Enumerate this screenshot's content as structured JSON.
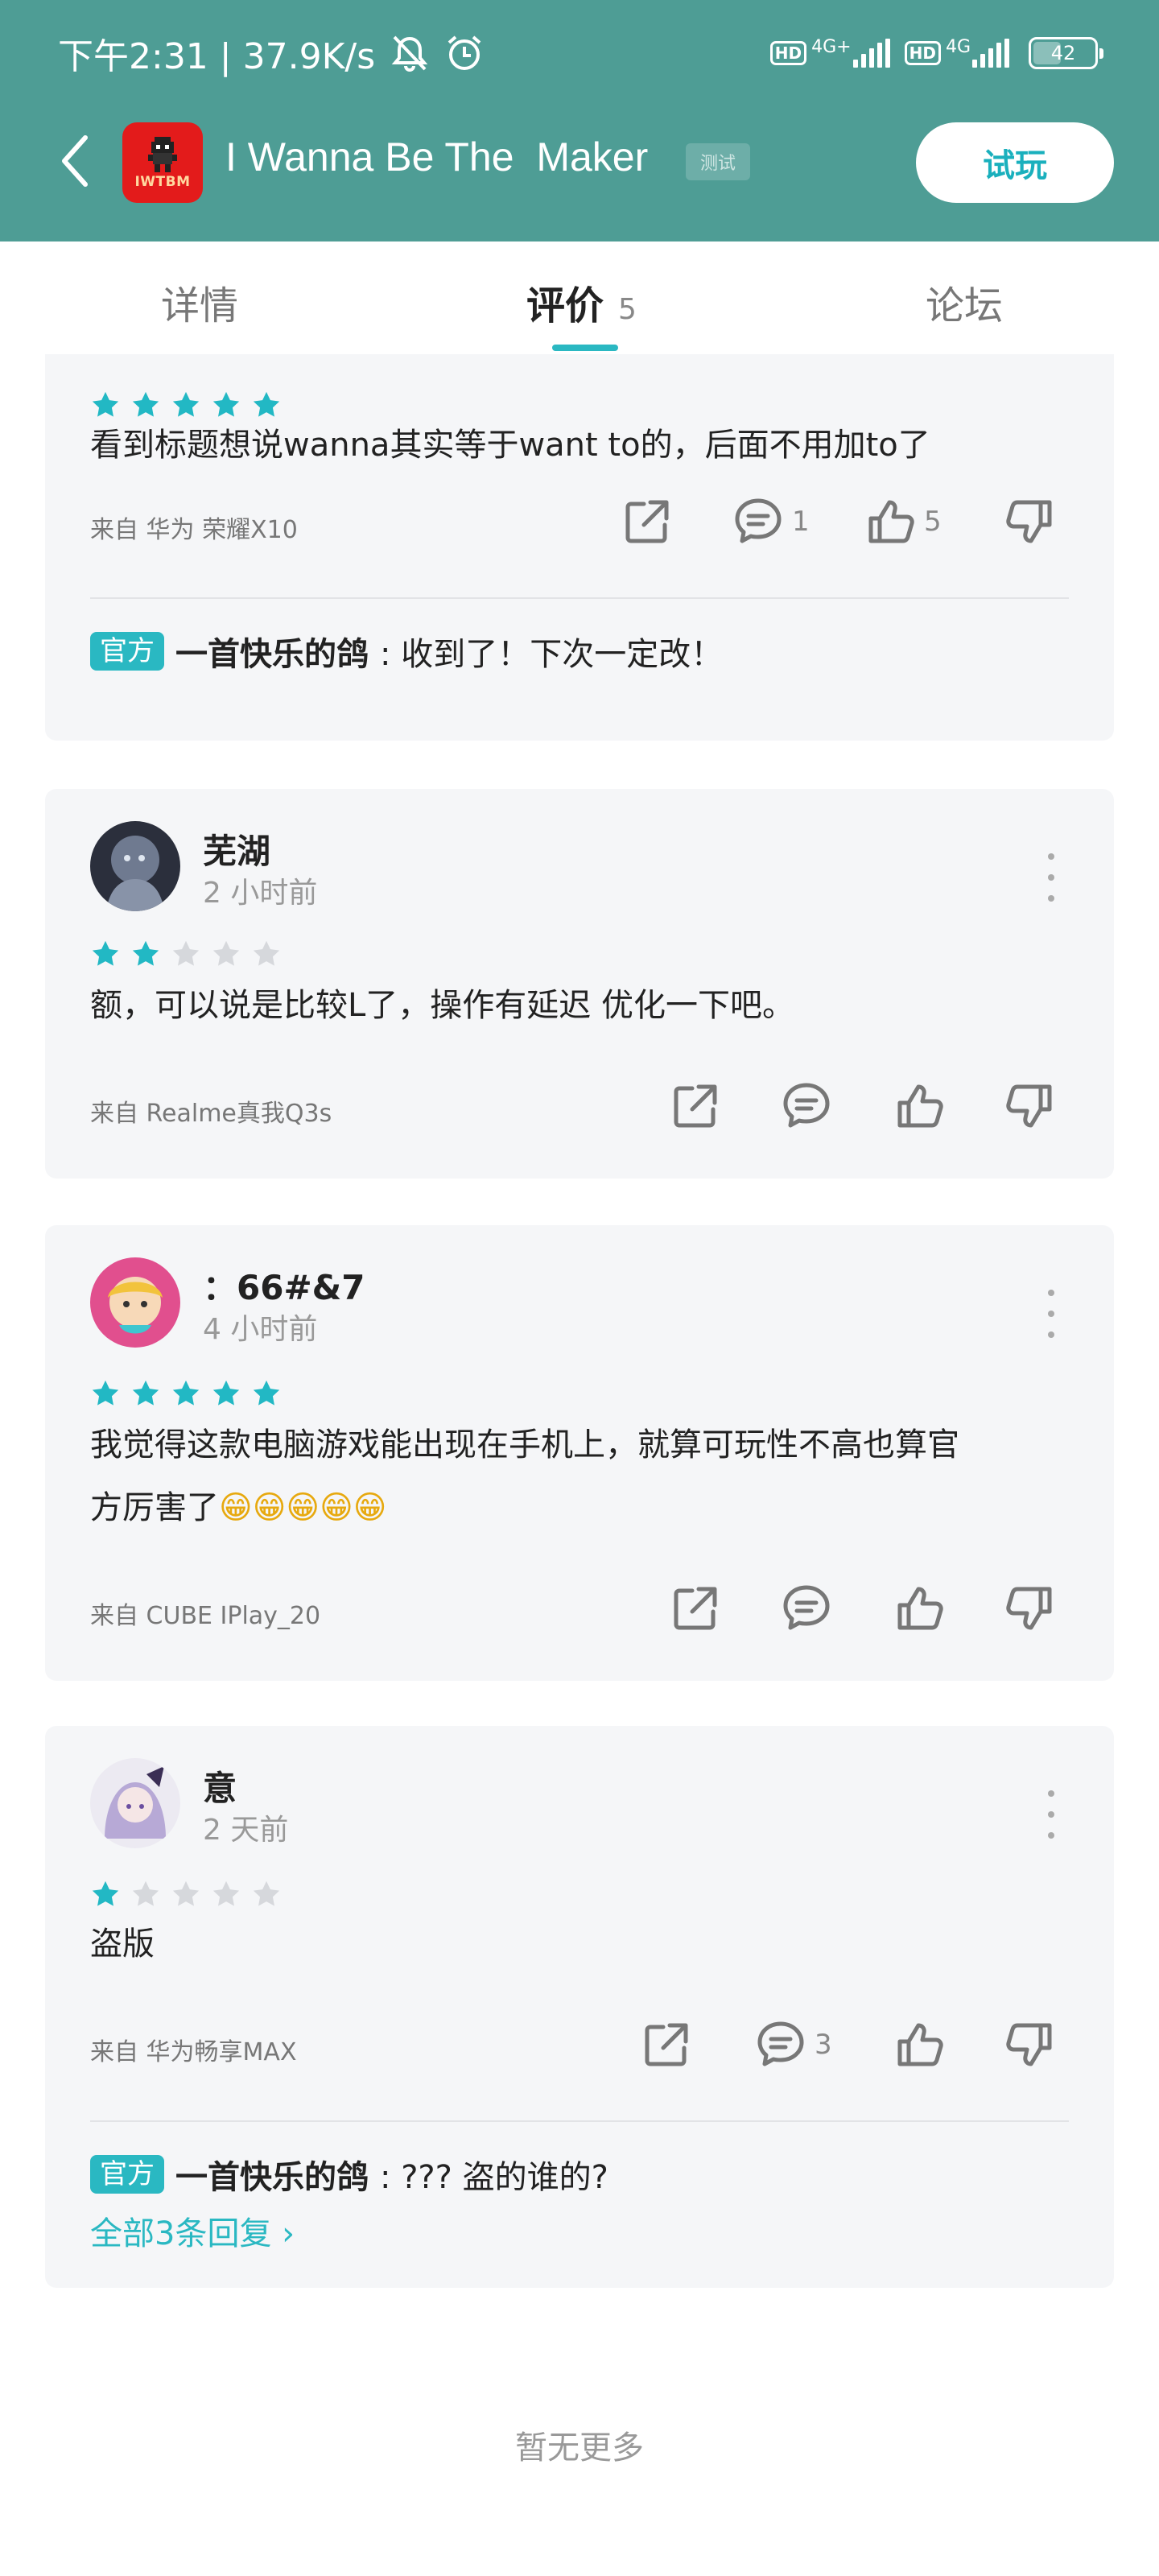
{
  "status_bar": {
    "time_speed": "下午2:31 | 37.9K/s",
    "icons": [
      "mute-icon",
      "alarm-icon"
    ],
    "hd1": "HD",
    "net1": "4G+",
    "hd2": "HD",
    "net2": "4G",
    "battery": "42"
  },
  "header": {
    "app_icon_text": "IWTBM",
    "title": "I Wanna Be The  Maker",
    "tag": "测试",
    "try_button": "试玩",
    "accent_color": "#4e9d95"
  },
  "tabs": [
    {
      "label": "详情"
    },
    {
      "label": "评价",
      "count": "5"
    },
    {
      "label": "论坛"
    }
  ],
  "reviews": [
    {
      "stars": 5,
      "text": "看到标题想说wanna其实等于want to的，后面不用加to了",
      "device": "来自 华为 荣耀X10",
      "comments": "1",
      "likes": "5",
      "official_reply": {
        "badge": "官方",
        "name": "一首快乐的鸽",
        "text": ": 收到了！下次一定改！"
      }
    },
    {
      "username": "芜湖",
      "time": "2 小时前",
      "stars": 2,
      "text": "额，可以说是比较L了，操作有延迟 优化一下吧。",
      "device": "来自 Realme真我Q3s"
    },
    {
      "username": "：66#&7",
      "time": "4 小时前",
      "stars": 5,
      "text_line1": "我觉得这款电脑游戏能出现在手机上，就算可玩性不高也算官",
      "text_line2": "方厉害了",
      "emojis": "😁😁😁😁😁",
      "device": "来自 CUBE IPlay_20"
    },
    {
      "username": "意",
      "time": "2 天前",
      "stars": 1,
      "text": "盗版",
      "device": "来自 华为畅享MAX",
      "comments": "3",
      "official_reply": {
        "badge": "官方",
        "name": "一首快乐的鸽",
        "text": ": ??? 盗的谁的?"
      },
      "all_replies": "全部3条回复 ›"
    }
  ],
  "footer": {
    "end_text": "暂无更多"
  },
  "colors": {
    "star_on": "#22b8c4",
    "star_off": "#d6d8dc",
    "link": "#2ab8c2"
  }
}
